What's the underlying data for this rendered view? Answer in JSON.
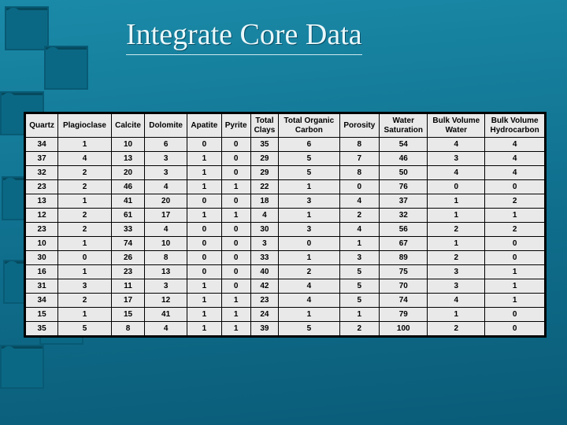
{
  "title": "Integrate Core Data",
  "chart_data": {
    "type": "table",
    "columns": [
      "Quartz",
      "Plagioclase",
      "Calcite",
      "Dolomite",
      "Apatite",
      "Pyrite",
      "Total Clays",
      "Total Organic Carbon",
      "Porosity",
      "Water Saturation",
      "Bulk Volume Water",
      "Bulk Volume Hydrocarbon"
    ],
    "header_lines": [
      [
        "Quartz"
      ],
      [
        "Plagioclase"
      ],
      [
        "Calcite"
      ],
      [
        "Dolomite"
      ],
      [
        "Apatite"
      ],
      [
        "Pyrite"
      ],
      [
        "Total",
        "Clays"
      ],
      [
        "Total Organic",
        "Carbon"
      ],
      [
        "Porosity"
      ],
      [
        "Water",
        "Saturation"
      ],
      [
        "Bulk Volume",
        "Water"
      ],
      [
        "Bulk Volume",
        "Hydrocarbon"
      ]
    ],
    "rows": [
      [
        34,
        1,
        10,
        6,
        0,
        0,
        35,
        6,
        8,
        54,
        4,
        4
      ],
      [
        37,
        4,
        13,
        3,
        1,
        0,
        29,
        5,
        7,
        46,
        3,
        4
      ],
      [
        32,
        2,
        20,
        3,
        1,
        0,
        29,
        5,
        8,
        50,
        4,
        4
      ],
      [
        23,
        2,
        46,
        4,
        1,
        1,
        22,
        1,
        0,
        76,
        0,
        0
      ],
      [
        13,
        1,
        41,
        20,
        0,
        0,
        18,
        3,
        4,
        37,
        1,
        2
      ],
      [
        12,
        2,
        61,
        17,
        1,
        1,
        4,
        1,
        2,
        32,
        1,
        1
      ],
      [
        23,
        2,
        33,
        4,
        0,
        0,
        30,
        3,
        4,
        56,
        2,
        2
      ],
      [
        10,
        1,
        74,
        10,
        0,
        0,
        3,
        0,
        1,
        67,
        1,
        0
      ],
      [
        30,
        0,
        26,
        8,
        0,
        0,
        33,
        1,
        3,
        89,
        2,
        0
      ],
      [
        16,
        1,
        23,
        13,
        0,
        0,
        40,
        2,
        5,
        75,
        3,
        1
      ],
      [
        31,
        3,
        11,
        3,
        1,
        0,
        42,
        4,
        5,
        70,
        3,
        1
      ],
      [
        34,
        2,
        17,
        12,
        1,
        1,
        23,
        4,
        5,
        74,
        4,
        1
      ],
      [
        15,
        1,
        15,
        41,
        1,
        1,
        24,
        1,
        1,
        79,
        1,
        0
      ],
      [
        35,
        5,
        8,
        4,
        1,
        1,
        39,
        5,
        2,
        100,
        2,
        0
      ]
    ]
  }
}
